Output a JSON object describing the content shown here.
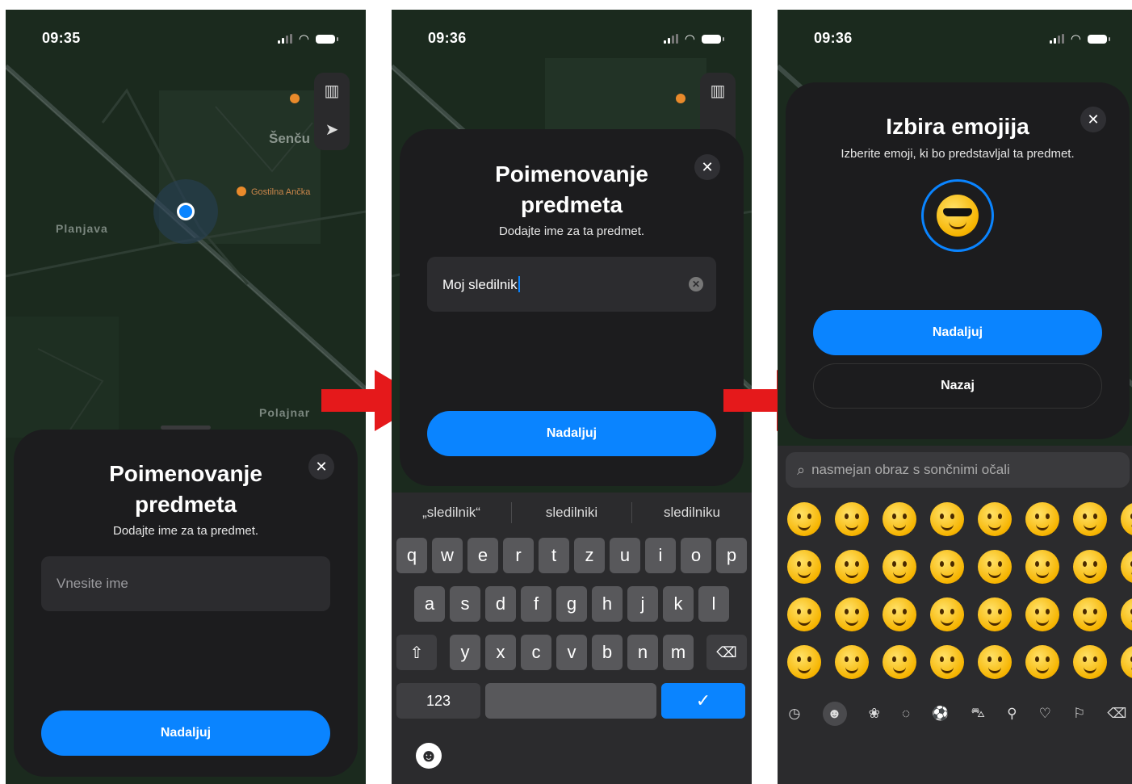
{
  "phones": [
    {
      "time": "09:35",
      "map": {
        "labels": [
          "Šenču",
          "Gostilna Ančka",
          "Planjava",
          "Polajnar"
        ]
      },
      "sheet": {
        "title_line1": "Poimenovanje",
        "title_line2": "predmeta",
        "subtitle": "Dodajte ime za ta predmet.",
        "input_placeholder": "Vnesite ime",
        "continue_label": "Nadaljuj"
      }
    },
    {
      "time": "09:36",
      "sheet": {
        "title_line1": "Poimenovanje",
        "title_line2": "predmeta",
        "subtitle": "Dodajte ime za ta predmet.",
        "input_value": "Moj sledilnik",
        "continue_label": "Nadaljuj"
      },
      "keyboard": {
        "suggestions": [
          "„sledilnik“",
          "sledilniki",
          "sledilniku"
        ],
        "row1": [
          "q",
          "w",
          "e",
          "r",
          "t",
          "z",
          "u",
          "i",
          "o",
          "p"
        ],
        "row2": [
          "a",
          "s",
          "d",
          "f",
          "g",
          "h",
          "j",
          "k",
          "l"
        ],
        "row3": [
          "y",
          "x",
          "c",
          "v",
          "b",
          "n",
          "m"
        ],
        "numbers_key": "123",
        "done_key": "✓"
      }
    },
    {
      "time": "09:36",
      "sheet": {
        "title": "Izbira emojija",
        "subtitle": "Izberite emoji, ki bo predstavljal ta predmet.",
        "continue_label": "Nadaljuj",
        "back_label": "Nazaj"
      },
      "emoji_keyboard": {
        "search_text": "nasmejan obraz s sončnimi očali",
        "categories": [
          "clock-icon",
          "smiley-icon",
          "animal-icon",
          "food-icon",
          "ball-icon",
          "car-icon",
          "bulb-icon",
          "heart-icon",
          "flag-icon"
        ]
      }
    }
  ],
  "colors": {
    "accent": "#0a84ff",
    "sheet": "#1c1c1e",
    "arrow": "#e5191b",
    "map": "#1b2a1e"
  }
}
